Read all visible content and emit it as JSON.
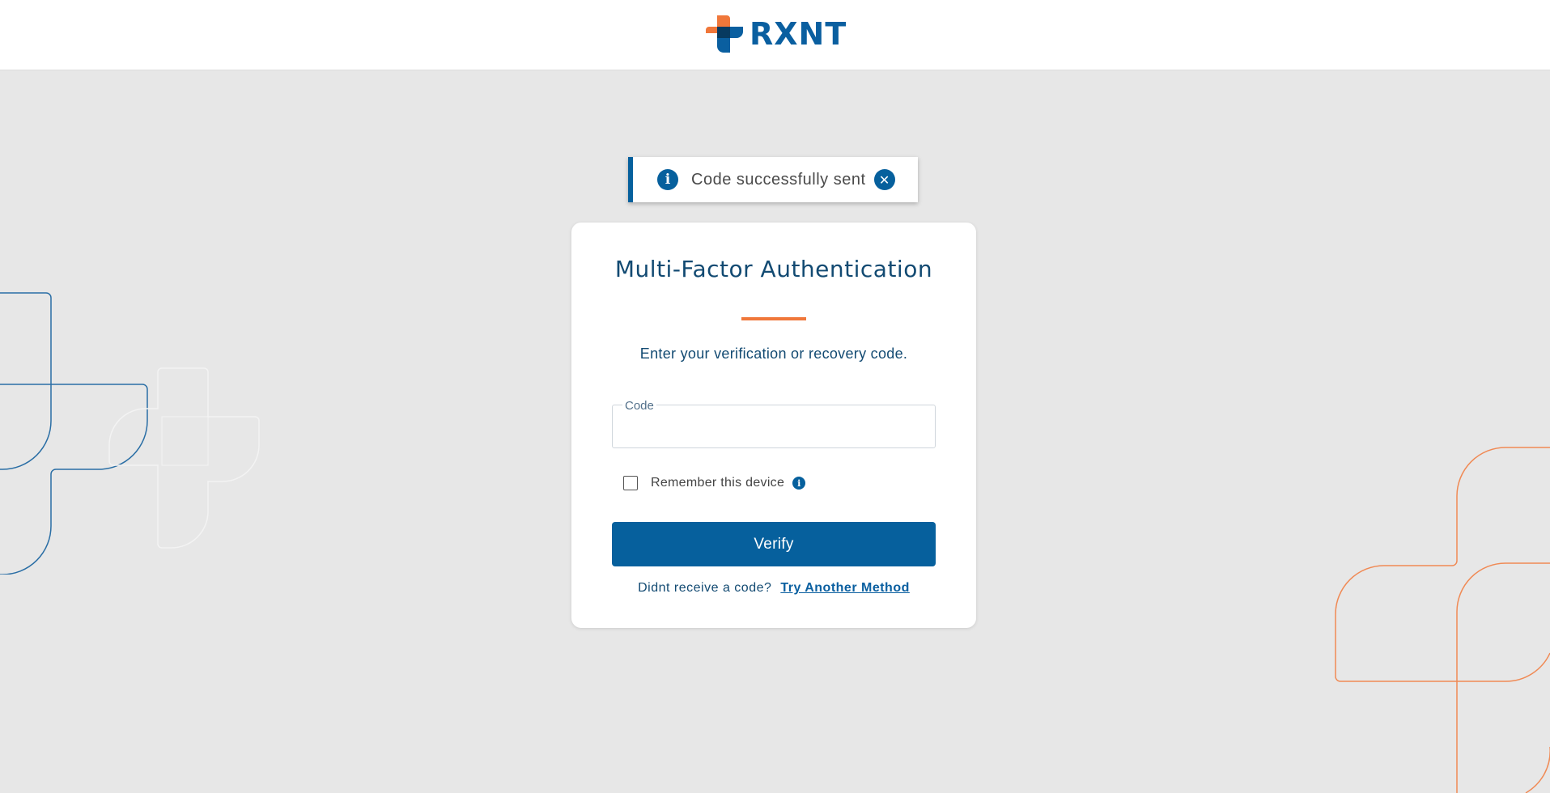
{
  "header": {
    "logo_text": "RXNT"
  },
  "toast": {
    "message": "Code successfully sent",
    "info_icon": "info-icon",
    "close_icon": "close-icon"
  },
  "card": {
    "title": "Multi-Factor Authentication",
    "subtitle": "Enter your verification or recovery code.",
    "code_field": {
      "label": "Code",
      "value": "",
      "placeholder": ""
    },
    "remember": {
      "label": "Remember this device",
      "checked": false
    },
    "verify_label": "Verify",
    "footer": {
      "prompt": "Didnt receive a code?",
      "link": "Try Another Method"
    }
  },
  "colors": {
    "brand_blue": "#06609d",
    "brand_orange": "#f0773a",
    "background": "#e7e7e7"
  }
}
